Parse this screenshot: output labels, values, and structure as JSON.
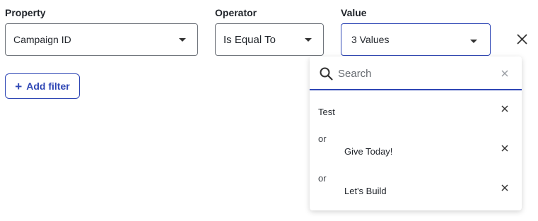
{
  "filter": {
    "property": {
      "label": "Property",
      "value": "Campaign ID"
    },
    "operator": {
      "label": "Operator",
      "value": "Is Equal To"
    },
    "value": {
      "label": "Value",
      "summary": "3 Values"
    }
  },
  "add_filter_label": "Add filter",
  "dropdown": {
    "search_placeholder": "Search",
    "items": [
      {
        "connector": "",
        "label": "Test"
      },
      {
        "connector": "or",
        "label": "Give Today!"
      },
      {
        "connector": "or",
        "label": "Let's Build"
      }
    ]
  },
  "colors": {
    "accent": "#2f47b5",
    "border": "#6f747b",
    "text": "#1f2329"
  },
  "icons": [
    "chevron-down-icon",
    "close-icon",
    "plus-icon",
    "search-icon"
  ]
}
